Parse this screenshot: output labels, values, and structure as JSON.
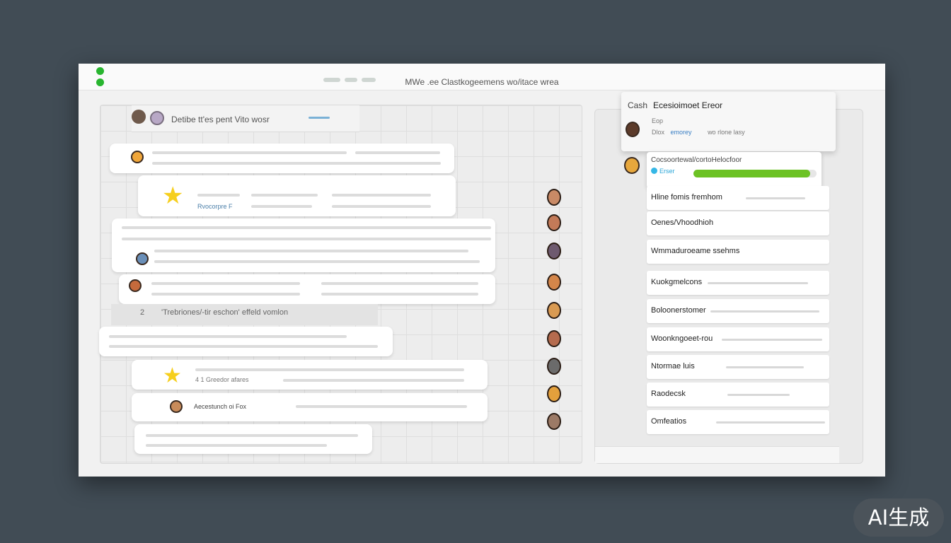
{
  "window": {
    "title": "MWe .ee Clastkogeemens wo/itace wrea",
    "accent": "#28b52f"
  },
  "chat": {
    "header_text": "Detibe tt'es pent  Vito wosr",
    "bubble_link_text": "Rvocorpre F",
    "caption_number": "2",
    "caption_text": "'Trebriones/-tir eschon' effeld vomlon",
    "star_bubble_text": "4  1 Greedor afares",
    "reply_label": "Aecestunch  oi  Fox"
  },
  "popup": {
    "title": "Cash",
    "title_bold": "Ecesioimoet Ereor",
    "sub": "Eop",
    "link_left": "Dlox",
    "link_mid": "emorey",
    "link_right": "wo rlone lasy"
  },
  "active_contact": {
    "name": "Cocsoortewal/cortoHelocfoor",
    "status": "Erser",
    "progress": 0.95,
    "progress_color": "#6cc224"
  },
  "contacts": [
    {
      "name": "Hline fomis fremhom"
    },
    {
      "name": "Oenes/Vhoodhioh"
    },
    {
      "name": "Wmmaduroeame ssehms"
    },
    {
      "name": "Kuokgmelcons"
    },
    {
      "name": "Boloonerstomer"
    },
    {
      "name": "Woonkngoeet-rou"
    },
    {
      "name": "Ntormae luis"
    },
    {
      "name": "Raodecsk"
    },
    {
      "name": "Omfeatios"
    }
  ],
  "badge": {
    "label": "AI生成"
  }
}
